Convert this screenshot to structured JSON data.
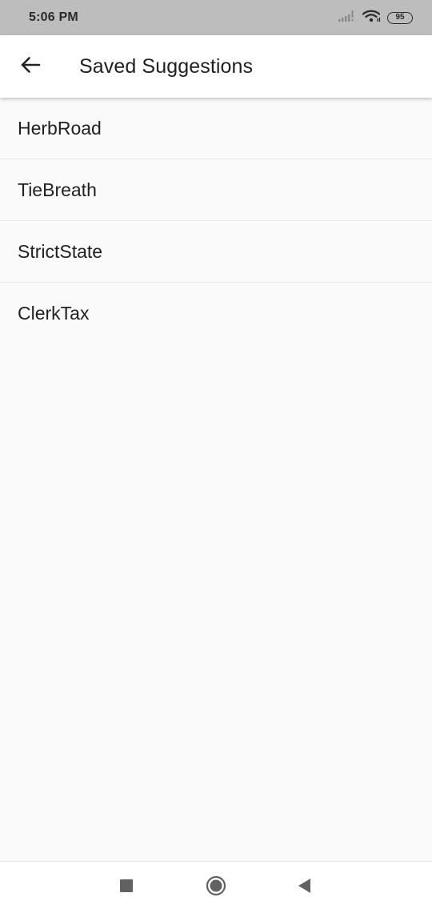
{
  "status_bar": {
    "time": "5:06 PM",
    "battery_level": "95",
    "icons": [
      "signal-icon",
      "wifi-icon",
      "battery-icon"
    ]
  },
  "app_bar": {
    "back_icon": "arrow-left-icon",
    "title": "Saved Suggestions"
  },
  "saved_list": {
    "items": [
      {
        "label": "HerbRoad"
      },
      {
        "label": "TieBreath"
      },
      {
        "label": "StrictState"
      },
      {
        "label": "ClerkTax"
      }
    ]
  },
  "nav_bar": {
    "icons": [
      "recents-square-icon",
      "home-circle-icon",
      "back-triangle-icon"
    ]
  },
  "colors": {
    "status_bar_bg": "#bdbdbd",
    "app_bar_bg": "#ffffff",
    "page_bg": "#fafafa",
    "text_primary": "#212121",
    "divider": "#e8e8e8"
  }
}
